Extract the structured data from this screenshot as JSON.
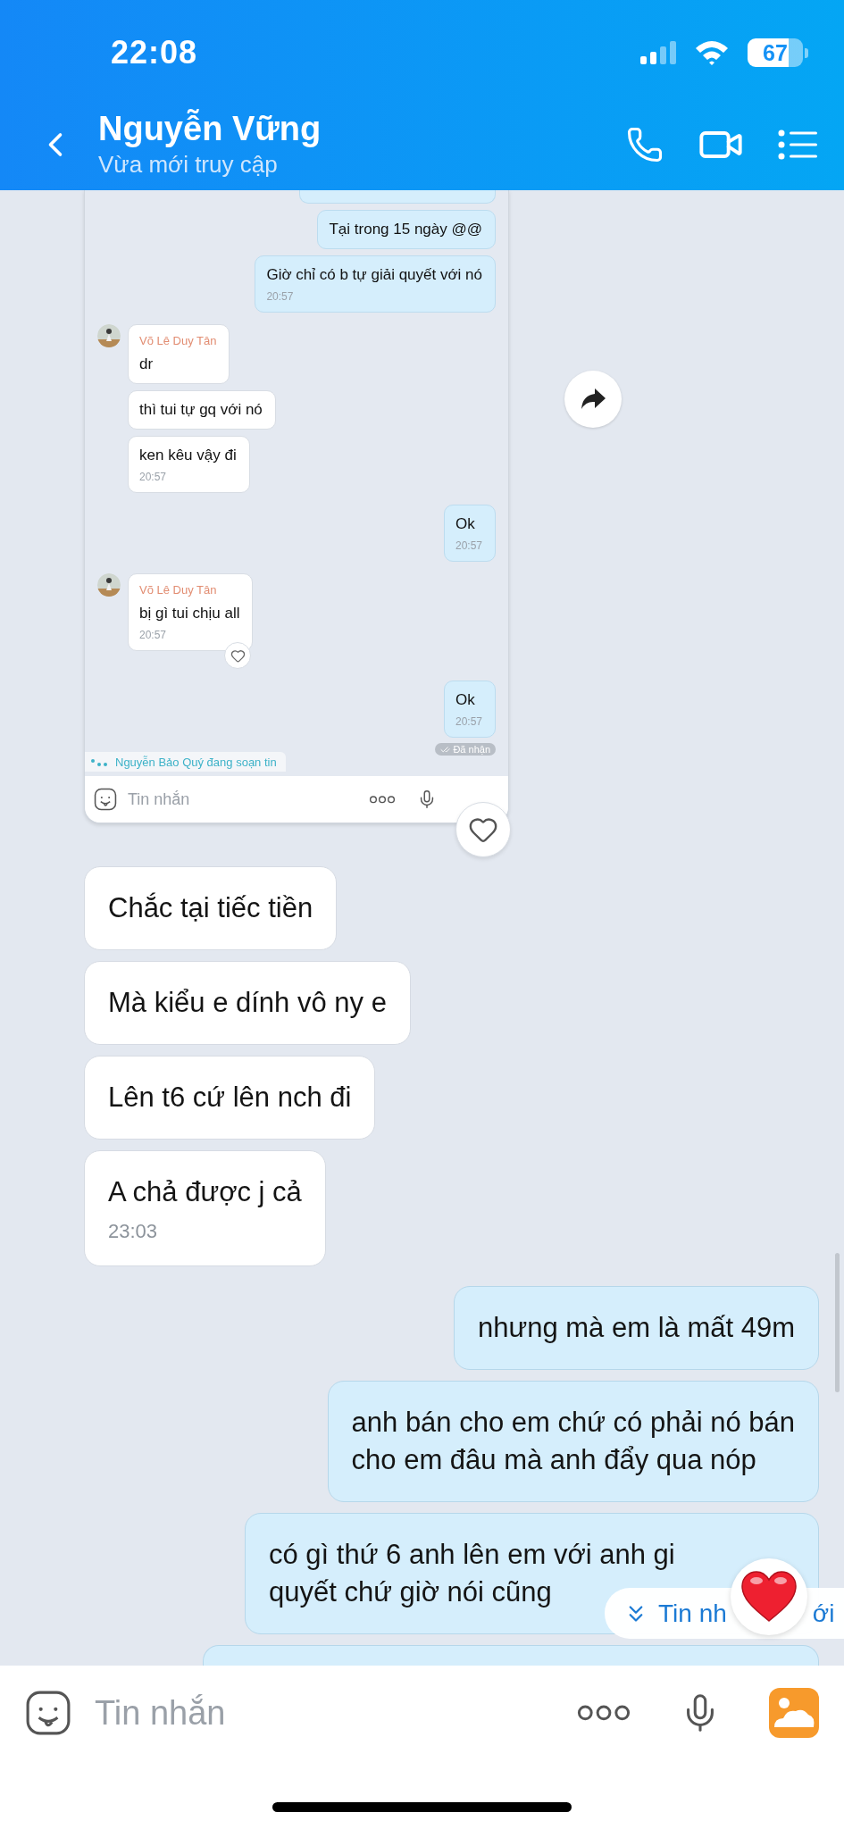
{
  "status_bar": {
    "time": "22:08",
    "battery": "67"
  },
  "header": {
    "title": "Nguyễn Vững",
    "subtitle": "Vừa mới truy cập"
  },
  "shared_screenshot": {
    "messages": [
      {
        "kind": "cut",
        "outgoing": true
      },
      {
        "kind": "text",
        "outgoing": true,
        "text": "Tại trong 15 ngày @@"
      },
      {
        "kind": "text",
        "outgoing": true,
        "text": "Giờ chỉ có b tự giải quyết với nó",
        "time": "20:57"
      },
      {
        "kind": "text",
        "outgoing": false,
        "sender": "Võ Lê Duy Tân",
        "text": "dr"
      },
      {
        "kind": "text",
        "outgoing": false,
        "text": "thì tui tự gq với nó"
      },
      {
        "kind": "text",
        "outgoing": false,
        "text": "ken kêu vậy đi",
        "time": "20:57"
      },
      {
        "kind": "text",
        "outgoing": true,
        "text": "Ok",
        "time": "20:57"
      },
      {
        "kind": "text",
        "outgoing": false,
        "sender": "Võ Lê Duy Tân",
        "text": "bị gì tui chịu all",
        "time": "20:57",
        "reaction_button": true
      },
      {
        "kind": "text",
        "outgoing": true,
        "text": "Ok",
        "time": "20:57",
        "status": "Đã nhận"
      }
    ],
    "typing": "Nguyễn Bảo Quý đang soạn tin",
    "input": {
      "placeholder": "Tin nhắn"
    }
  },
  "messages": [
    {
      "kind": "text",
      "outgoing": false,
      "text": "Chắc tại tiếc tiền"
    },
    {
      "kind": "text",
      "outgoing": false,
      "text": "Mà kiểu e dính vô ny e"
    },
    {
      "kind": "text",
      "outgoing": false,
      "text": "Lên t6 cứ lên nch đi"
    },
    {
      "kind": "text",
      "outgoing": false,
      "text": "A chả được j cả",
      "time": "23:03"
    },
    {
      "kind": "text",
      "outgoing": true,
      "text": "nhưng mà em là mất 49m"
    },
    {
      "kind": "text",
      "outgoing": true,
      "text": "anh bán cho em chứ có phải nó bán\ncho em đâu mà anh đẩy qua nóp"
    },
    {
      "kind": "text",
      "outgoing": true,
      "covered": true,
      "text": "có gì thứ 6 anh lên em với anh gi\nquyết chứ giờ nói cũng"
    },
    {
      "kind": "cut",
      "outgoing": true
    }
  ],
  "new_messages_button": {
    "text_parts": [
      "Tin nh",
      "ới"
    ]
  },
  "composer": {
    "placeholder": "Tin nhắn"
  }
}
